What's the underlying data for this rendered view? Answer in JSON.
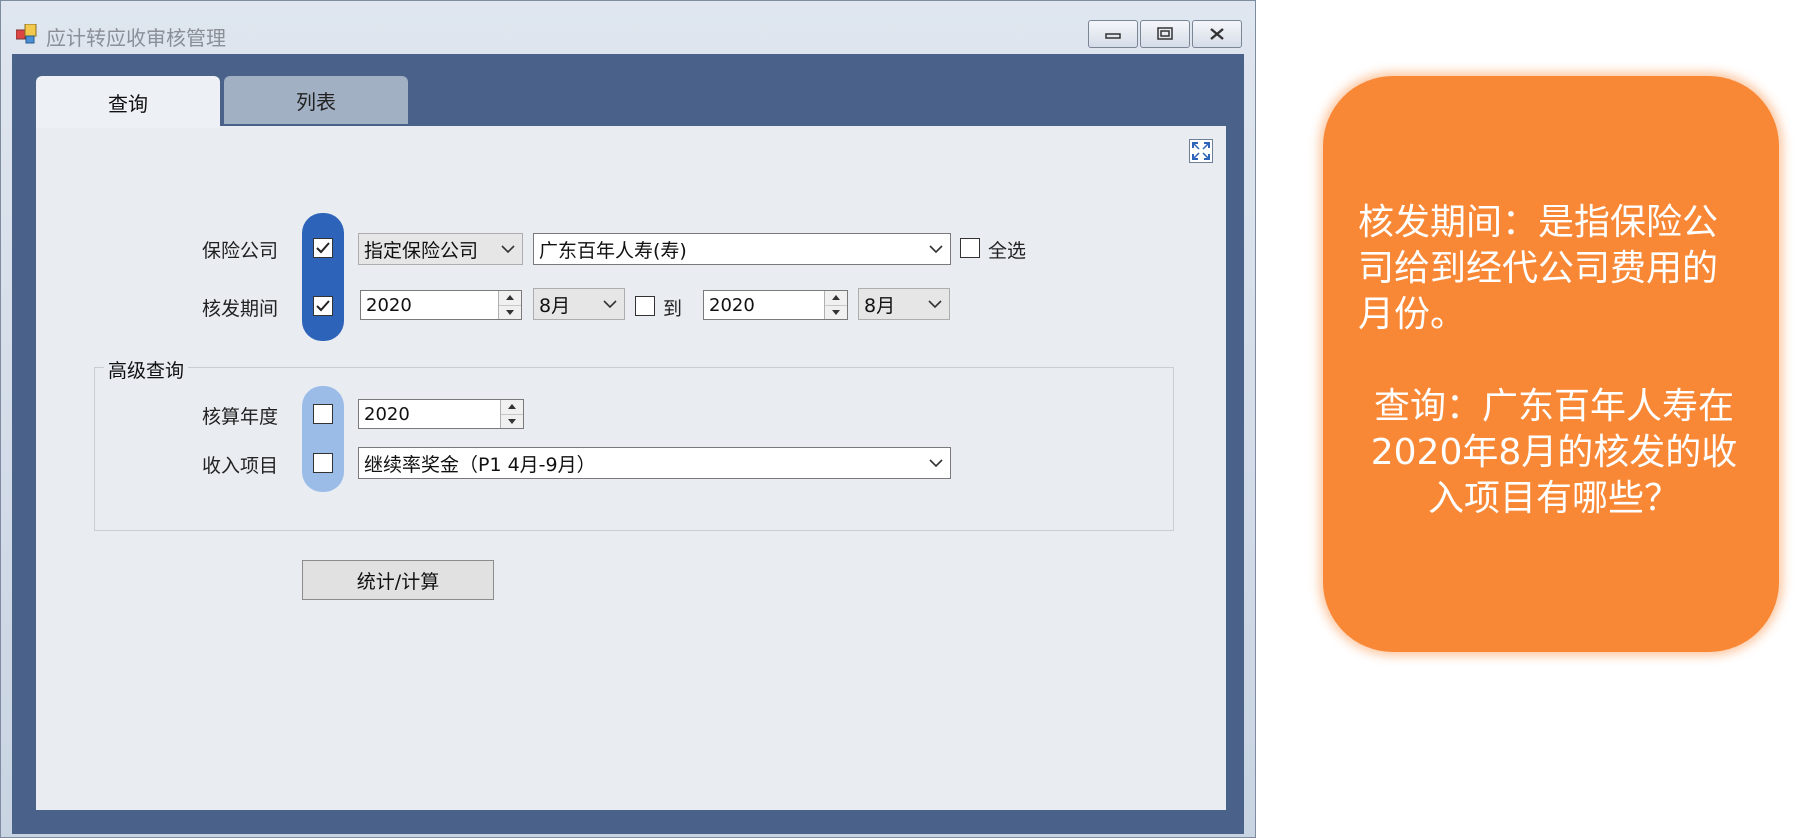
{
  "window": {
    "title": "应计转应收审核管理"
  },
  "tabs": [
    {
      "label": "查询",
      "active": true
    },
    {
      "label": "列表",
      "active": false
    }
  ],
  "query": {
    "insurer": {
      "label": "保险公司",
      "checked": true,
      "mode": "指定保险公司",
      "company": "广东百年人寿(寿)",
      "select_all_label": "全选",
      "select_all_checked": false
    },
    "period": {
      "label": "核发期间",
      "checked": true,
      "from_year": "2020",
      "from_month": "8月",
      "to_label": "到",
      "to_checked": false,
      "to_year": "2020",
      "to_month": "8月"
    },
    "advanced": {
      "title": "高级查询",
      "year": {
        "label": "核算年度",
        "checked": false,
        "value": "2020"
      },
      "income": {
        "label": "收入项目",
        "checked": false,
        "value": "继续率奖金（P1 4月-9月）"
      }
    },
    "button": "统计/计算"
  },
  "callout": {
    "para1": "核发期间：是指保险公司给到经代公司费用的月份。",
    "para2": "查询：广东百年人寿在2020年8月的核发的收入项目有哪些？"
  },
  "colors": {
    "client_bg": "#4a628a",
    "pill_dark": "#2d63b8",
    "pill_light": "#9cbce8",
    "callout": "#f98836"
  }
}
